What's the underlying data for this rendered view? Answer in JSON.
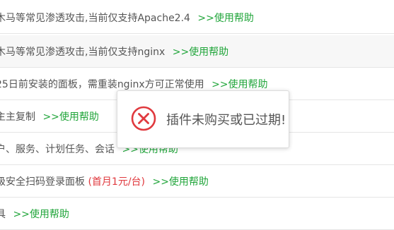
{
  "rows": [
    {
      "text": "木马等常见渗透攻击,当前仅支持Apache2.4",
      "help": ">>使用帮助"
    },
    {
      "text": "木马等常见渗透攻击,当前仅支持nginx",
      "help": ">>使用帮助"
    },
    {
      "text": "25日前安装的面板，需重装nginx方可正常使用",
      "help": ">>使用帮助"
    },
    {
      "text": "主主复制",
      "help": ">>使用帮助"
    },
    {
      "text": "户、服务、计划任务、会话",
      "help": ">>使用帮助"
    },
    {
      "text": "级安全扫码登录面板",
      "price": "(首月1元/台)",
      "help": ">>使用帮助"
    },
    {
      "text": "具",
      "help": ">>使用帮助"
    }
  ],
  "dialog": {
    "message": "插件未购买或已过期!",
    "icon": "error-circle-icon"
  },
  "colors": {
    "help_link": "#20a53a",
    "price": "#e0393e",
    "error_icon": "#e0393e"
  }
}
